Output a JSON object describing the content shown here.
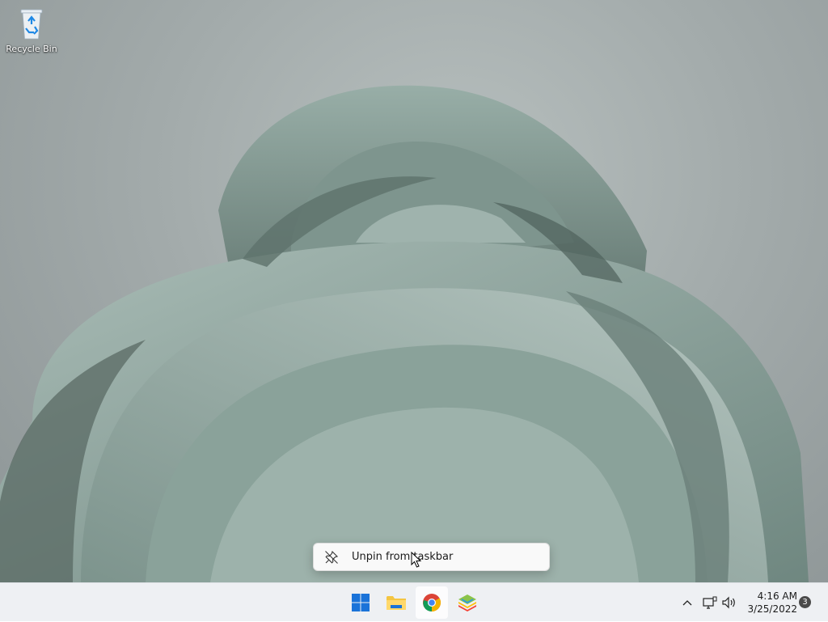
{
  "desktop": {
    "icons": [
      {
        "label": "Recycle Bin",
        "icon": "recycle-bin-icon"
      }
    ]
  },
  "context_menu": {
    "items": [
      {
        "label": "Unpin from taskbar",
        "icon": "unpin-icon"
      }
    ]
  },
  "taskbar": {
    "apps": [
      {
        "name": "start",
        "icon": "windows-start-icon"
      },
      {
        "name": "file-explorer",
        "icon": "folder-icon"
      },
      {
        "name": "chrome",
        "icon": "chrome-icon"
      },
      {
        "name": "bluestacks",
        "icon": "bluestacks-icon"
      }
    ],
    "tray": {
      "time": "4:16 AM",
      "date": "3/25/2022",
      "notification_count": "3"
    }
  },
  "colors": {
    "taskbar_bg": "#eef0f3",
    "windows_blue": "#0f6cbd",
    "wallpaper_petal": "#8fa7a0"
  }
}
